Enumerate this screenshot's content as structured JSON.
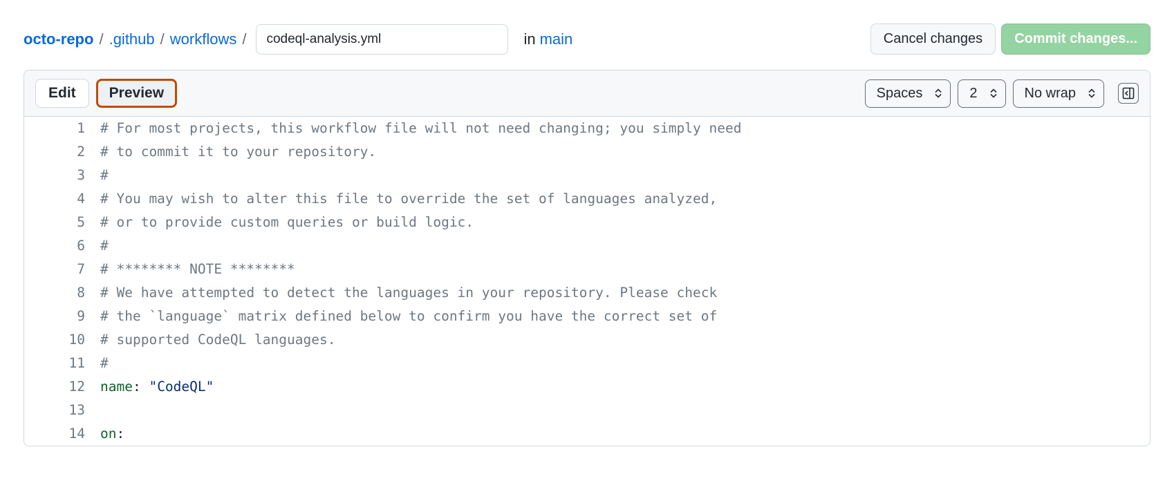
{
  "breadcrumb": {
    "repo": "octo-repo",
    "path1": ".github",
    "path2": "workflows",
    "sep": "/"
  },
  "filename_value": "codeql-analysis.yml",
  "in_label": "in",
  "branch": "main",
  "buttons": {
    "cancel": "Cancel changes",
    "commit": "Commit changes..."
  },
  "tabs": {
    "edit": "Edit",
    "preview": "Preview"
  },
  "selects": {
    "indent": "Spaces",
    "indent_size": "2",
    "wrap": "No wrap"
  },
  "code_lines": [
    {
      "n": 1,
      "kind": "comment",
      "text": "# For most projects, this workflow file will not need changing; you simply need"
    },
    {
      "n": 2,
      "kind": "comment",
      "text": "# to commit it to your repository."
    },
    {
      "n": 3,
      "kind": "comment",
      "text": "#"
    },
    {
      "n": 4,
      "kind": "comment",
      "text": "# You may wish to alter this file to override the set of languages analyzed,"
    },
    {
      "n": 5,
      "kind": "comment",
      "text": "# or to provide custom queries or build logic."
    },
    {
      "n": 6,
      "kind": "comment",
      "text": "#"
    },
    {
      "n": 7,
      "kind": "comment",
      "text": "# ******** NOTE ********"
    },
    {
      "n": 8,
      "kind": "comment",
      "text": "# We have attempted to detect the languages in your repository. Please check"
    },
    {
      "n": 9,
      "kind": "comment",
      "text": "# the `language` matrix defined below to confirm you have the correct set of"
    },
    {
      "n": 10,
      "kind": "comment",
      "text": "# supported CodeQL languages."
    },
    {
      "n": 11,
      "kind": "comment",
      "text": "#"
    },
    {
      "n": 12,
      "kind": "kv",
      "key": "name",
      "sep": ": ",
      "val": "\"CodeQL\""
    },
    {
      "n": 13,
      "kind": "blank",
      "text": ""
    },
    {
      "n": 14,
      "kind": "kv",
      "key": "on",
      "sep": ":",
      "val": ""
    }
  ]
}
